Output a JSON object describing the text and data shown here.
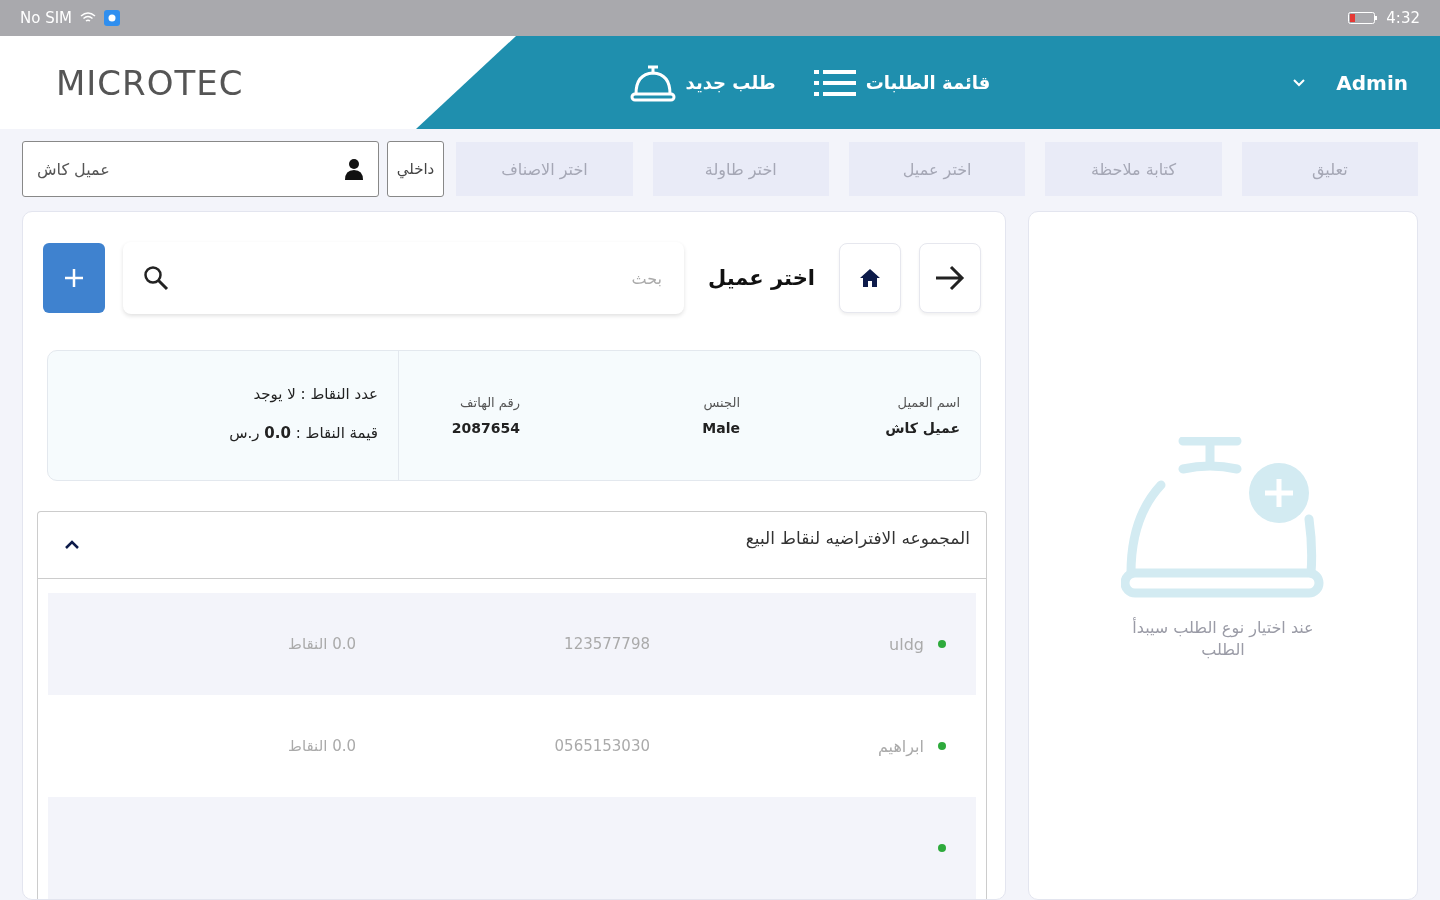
{
  "status_bar": {
    "carrier": "No SIM",
    "time": "4:32"
  },
  "header": {
    "logo": "MICROTEC",
    "user": "Admin",
    "nav": [
      {
        "label": "قائمة الطلبات",
        "kind": "list"
      },
      {
        "label": "طلب جديد",
        "kind": "bell"
      }
    ]
  },
  "toolbar": {
    "tabs": [
      "تعليق",
      "كتابة ملاحظة",
      "اختر عميل",
      "اختر طاولة",
      "اختر الاصناف"
    ],
    "order_type": "داخلي",
    "customer": "عميل كاش"
  },
  "customer_panel": {
    "title": "اختر عميل",
    "search": {
      "placeholder": "بحث"
    },
    "details": {
      "columns": [
        {
          "label": "اسم العميل",
          "value": "عميل كاش"
        },
        {
          "label": "الجنس",
          "value": "Male"
        },
        {
          "label": "رقم الهاتف",
          "value": "2087654"
        }
      ],
      "points_count": "عدد النقاط : لا يوجد",
      "points_value": "قيمة النقاط : **0.0** ر.س"
    },
    "group": {
      "title": "المجموعه الافتراضيه لنقاط البيع",
      "expanded": true,
      "rows": [
        {
          "name": "uldg",
          "phone": "123577798",
          "points": "0.0 النقاط",
          "color": "#2eaa3c"
        },
        {
          "name": "ابراهيم",
          "phone": "0565153030",
          "points": "0.0 النقاط",
          "color": "#2eaa3c"
        },
        {
          "color": "#2eaa3c"
        }
      ]
    }
  },
  "order_panel": {
    "empty_message": "عند اختيار نوع الطلب سيبدأ الطلب"
  }
}
